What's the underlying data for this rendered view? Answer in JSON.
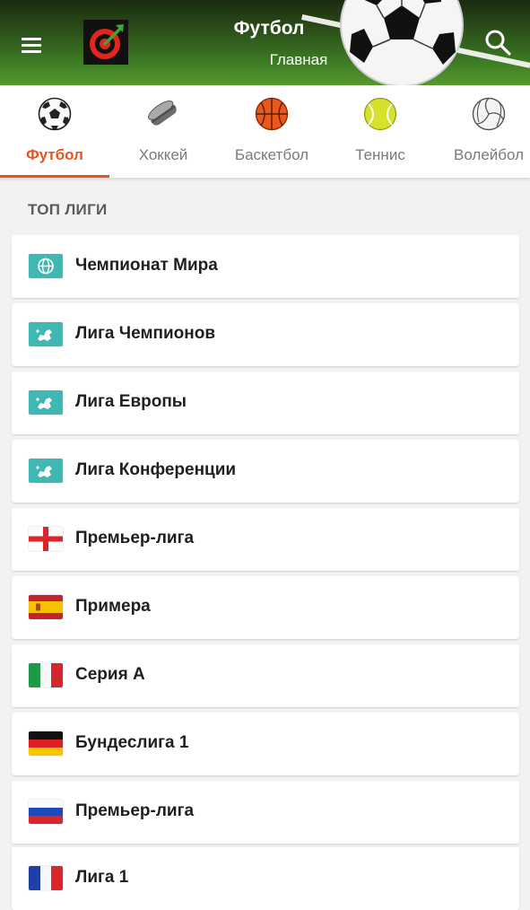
{
  "header": {
    "title": "Футбол",
    "subtitle": "Главная",
    "menu_icon": "hamburger-menu-icon",
    "logo_icon": "target-logo-icon",
    "search_icon": "search-icon"
  },
  "tabs": [
    {
      "label": "Футбол",
      "icon": "soccer-ball-icon",
      "active": true
    },
    {
      "label": "Хоккей",
      "icon": "hockey-puck-icon",
      "active": false
    },
    {
      "label": "Баскетбол",
      "icon": "basketball-icon",
      "active": false
    },
    {
      "label": "Теннис",
      "icon": "tennis-ball-icon",
      "active": false
    },
    {
      "label": "Волейбол",
      "icon": "volleyball-icon",
      "active": false
    }
  ],
  "section": {
    "title": "ТОП ЛИГИ"
  },
  "leagues": [
    {
      "name": "Чемпионат Мира",
      "flag": "world-icon"
    },
    {
      "name": "Лига Чемпионов",
      "flag": "europe-icon"
    },
    {
      "name": "Лига Европы",
      "flag": "europe-icon"
    },
    {
      "name": "Лига Конференции",
      "flag": "europe-icon"
    },
    {
      "name": "Премьер-лига",
      "flag": "england-flag"
    },
    {
      "name": "Примера",
      "flag": "spain-flag"
    },
    {
      "name": "Серия А",
      "flag": "italy-flag"
    },
    {
      "name": "Бундеслига 1",
      "flag": "germany-flag"
    },
    {
      "name": "Премьер-лига",
      "flag": "russia-flag"
    },
    {
      "name": "Лига 1",
      "flag": "france-flag"
    }
  ],
  "colors": {
    "accent": "#e8541f",
    "intl_badge": "#3fb7b3"
  }
}
